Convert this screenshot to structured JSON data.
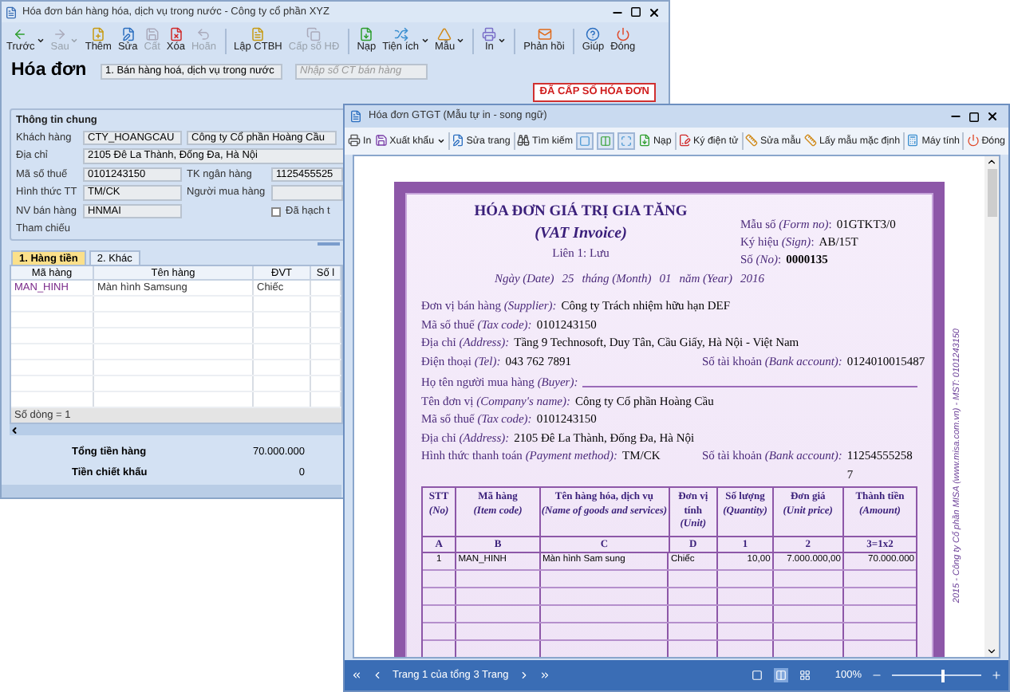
{
  "main_window": {
    "title": "Hóa đơn bán hàng hóa, dịch vụ trong nước - Công ty cổ phần XYZ",
    "toolbar": [
      {
        "label": "Trước",
        "disabled": false,
        "dropdown": true
      },
      {
        "label": "Sau",
        "disabled": true,
        "dropdown": true
      },
      {
        "label": "Thêm",
        "disabled": false,
        "dropdown": false
      },
      {
        "label": "Sửa",
        "disabled": false,
        "dropdown": false
      },
      {
        "label": "Cất",
        "disabled": true,
        "dropdown": false
      },
      {
        "label": "Xóa",
        "disabled": false,
        "dropdown": false
      },
      {
        "label": "Hoãn",
        "disabled": true,
        "dropdown": false
      },
      {
        "label": "Lập CTBH",
        "disabled": false,
        "dropdown": false
      },
      {
        "label": "Cấp số HĐ",
        "disabled": true,
        "dropdown": false
      },
      {
        "label": "Nạp",
        "disabled": false,
        "dropdown": false
      },
      {
        "label": "Tiện ích",
        "disabled": false,
        "dropdown": true
      },
      {
        "label": "Mẫu",
        "disabled": false,
        "dropdown": true
      },
      {
        "label": "In",
        "disabled": false,
        "dropdown": true
      },
      {
        "label": "Phản hồi",
        "disabled": false,
        "dropdown": false
      },
      {
        "label": "Giúp",
        "disabled": false,
        "dropdown": false
      },
      {
        "label": "Đóng",
        "disabled": false,
        "dropdown": false
      }
    ],
    "heading": "Hóa đơn",
    "type_field": {
      "value": "1. Bán hàng hoá, dịch vụ trong nước"
    },
    "number_field": {
      "placeholder": "Nhập số CT bán hàng"
    },
    "status_badge": "ĐÃ CẤP SỐ HÓA ĐƠN",
    "general_info": {
      "title": "Thông tin chung",
      "customer": {
        "label": "Khách hàng",
        "code": "CTY_HOANGCAU",
        "name": "Công ty Cổ phần Hoàng Cầu"
      },
      "address": {
        "label": "Địa chỉ",
        "value": "2105 Đê La Thành, Đống Đa, Hà Nội"
      },
      "tax_code": {
        "label": "Mã số thuế",
        "value": "0101243150"
      },
      "bank_account": {
        "label": "TK ngân hàng",
        "value": "1125455525"
      },
      "payment": {
        "label": "Hình thức TT",
        "value": "TM/CK"
      },
      "buyer": {
        "label": "Người mua hàng"
      },
      "salesperson": {
        "label": "NV bán hàng",
        "value": "HNMAI"
      },
      "posted": {
        "label": "Đã hạch t",
        "checked": false
      },
      "reference": {
        "label": "Tham chiếu"
      }
    },
    "tabs": [
      {
        "label": "1. Hàng tiền",
        "selected": true
      },
      {
        "label": "2. Khác",
        "selected": false
      }
    ],
    "grid": {
      "columns": [
        "Mã hàng",
        "Tên hàng",
        "ĐVT",
        "Số l"
      ],
      "rows": [
        {
          "cells": [
            "MAN_HINH",
            "Màn hình Samsung",
            "Chiếc"
          ]
        }
      ],
      "footer": "Số dòng = 1"
    },
    "summary": [
      {
        "label": "Tổng tiền hàng",
        "value": "70.000.000"
      },
      {
        "label": "Tiền chiết khấu",
        "value": "0"
      }
    ]
  },
  "invoice_window": {
    "title": "Hóa đơn GTGT (Mẫu tự in - song ngữ)",
    "toolbar": [
      {
        "kind": "button",
        "label": "In",
        "dropdown": false
      },
      {
        "kind": "button",
        "label": "Xuất khẩu",
        "dropdown": true
      },
      {
        "kind": "button",
        "label": "Sửa trang",
        "dropdown": false
      },
      {
        "kind": "button",
        "label": "Tìm kiếm",
        "dropdown": false
      },
      {
        "kind": "icon",
        "dropdown": false
      },
      {
        "kind": "icon",
        "dropdown": false
      },
      {
        "kind": "icon",
        "dropdown": false
      },
      {
        "kind": "button",
        "label": "Nạp",
        "dropdown": false
      },
      {
        "kind": "button",
        "label": "Ký điện tử",
        "dropdown": false
      },
      {
        "kind": "button",
        "label": "Sửa mẫu",
        "dropdown": false
      },
      {
        "kind": "button",
        "label": "Lấy mẫu mặc định",
        "dropdown": false
      },
      {
        "kind": "button",
        "label": "Máy tính",
        "dropdown": false
      },
      {
        "kind": "button",
        "label": "Đóng",
        "dropdown": false
      }
    ],
    "invoice": {
      "title": "HÓA ĐƠN GIÁ TRỊ GIA TĂNG",
      "subtitle": "(VAT Invoice)",
      "copy": "Liên 1: Lưu",
      "meta": [
        {
          "label": "Mẫu số *(Form no)*:",
          "value": "01GTKT3/0",
          "emphasis": false
        },
        {
          "label": "Ký hiệu *(Sign)*:",
          "value": "AB/15T",
          "emphasis": false
        },
        {
          "label": "Số *(No)*:",
          "value": "0000135",
          "emphasis": true
        }
      ],
      "date": [
        "Ngày (Date)",
        "25",
        "tháng (Month)",
        "01",
        "năm (Year)",
        "2016"
      ],
      "seller": [
        {
          "fields": [
            {
              "label": "Đơn vị bán hàng *(Supplier):*",
              "value": "Công ty Trách nhiệm hữu hạn DEF"
            }
          ]
        },
        {
          "fields": [
            {
              "label": "Mã số thuế *(Tax code):*",
              "value": "0101243150"
            }
          ]
        },
        {
          "fields": [
            {
              "label": "Địa chỉ *(Address):*",
              "value": "Tầng 9 Technosoft, Duy Tân, Cầu Giấy, Hà Nội - Việt Nam"
            }
          ]
        },
        {
          "fields": [
            {
              "label": "Điện thoại *(Tel):*",
              "value": "043 762 7891"
            },
            {
              "label": "Số tài khoản *(Bank account):*",
              "value": "0124010015487"
            }
          ]
        }
      ],
      "buyer": [
        {
          "fields": [
            {
              "label": "Họ tên người mua hàng *(Buyer):*"
            }
          ]
        },
        {
          "fields": [
            {
              "label": "Tên đơn vị *(Company's name):*",
              "value": "Công ty Cổ phần Hoàng Cầu"
            }
          ]
        },
        {
          "fields": [
            {
              "label": "Mã số thuế *(Tax code):*",
              "value": "0101243150"
            }
          ]
        },
        {
          "fields": [
            {
              "label": "Địa chỉ *(Address):*",
              "value": "2105 Đê La Thành, Đống Đa, Hà Nội"
            }
          ]
        },
        {
          "fields": [
            {
              "label": "Hình thức thanh toán *(Payment method):*",
              "value": "TM/CK"
            },
            {
              "label": "Số tài khoản *(Bank account):*",
              "value": "112545552587"
            }
          ]
        }
      ],
      "table": {
        "columns": [
          {
            "label": "STT",
            "label_en": "(No)",
            "code": "A"
          },
          {
            "label": "Mã hàng",
            "label_en": "(Item code)",
            "code": "B"
          },
          {
            "label": "Tên hàng hóa, dịch vụ",
            "label_en": "(Name of goods and services)",
            "code": "C"
          },
          {
            "label": "Đơn vị tính",
            "label_en": "(Unit)",
            "code": "D"
          },
          {
            "label": "Số lượng",
            "label_en": "(Quantity)",
            "code": "1"
          },
          {
            "label": "Đơn giá",
            "label_en": "(Unit price)",
            "code": "2"
          },
          {
            "label": "Thành tiền",
            "label_en": "(Amount)",
            "code": "3=1x2"
          }
        ],
        "rows": [
          {
            "cells": [
              "1",
              "MAN_HINH",
              "Màn hình Sam sung",
              "Chiếc",
              "10,00",
              "7.000.000,00",
              "70.000.000"
            ]
          }
        ]
      },
      "side_note": "2015 - Công ty Cổ phần MISA (www.misa.com.vn) - MST: 0101243150"
    },
    "status_bar": {
      "page": "Trang 1 của tổng 3 Trang",
      "view_modes": [
        {
          "selected": false
        },
        {
          "selected": true
        },
        {
          "selected": false
        }
      ],
      "zoom": "100%",
      "zoom_slider": {
        "level": 0.55
      }
    }
  }
}
